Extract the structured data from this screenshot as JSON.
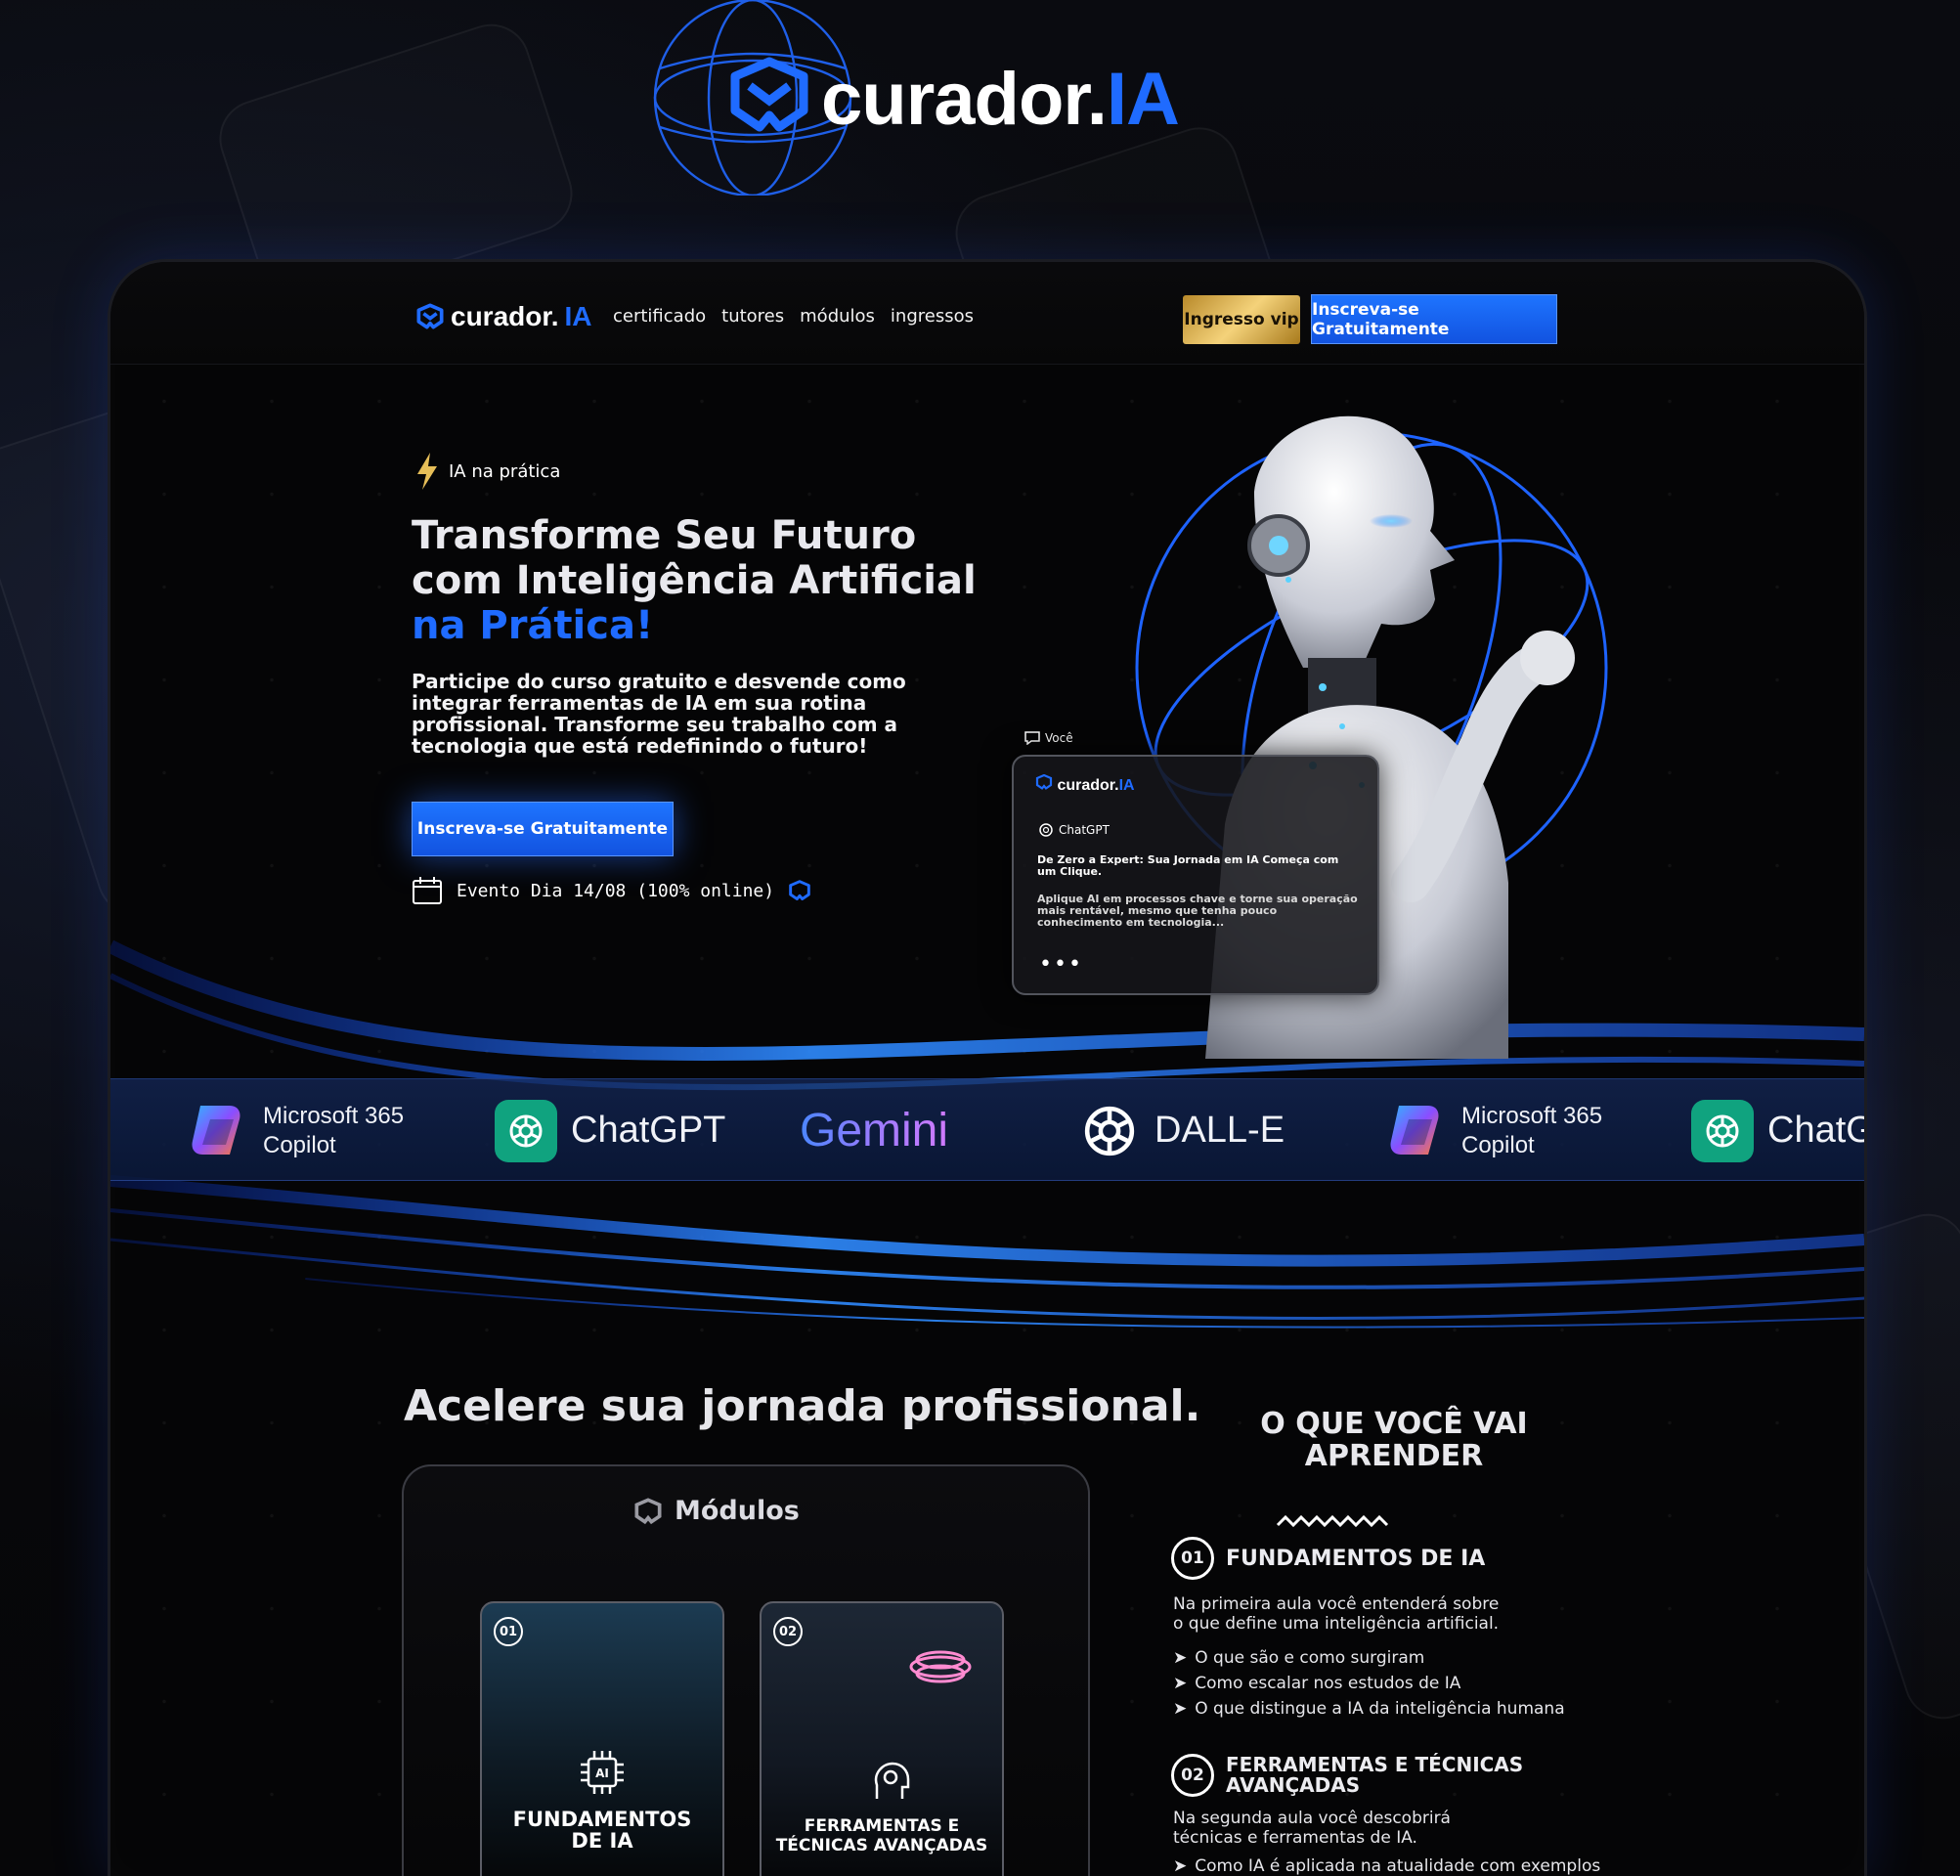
{
  "brand": {
    "name": "curador.",
    "suffix": "IA"
  },
  "nav": {
    "links": [
      "certificado",
      "tutores",
      "módulos",
      "ingressos"
    ],
    "vip_button": "Ingresso vip",
    "cta_button": "Inscreva-se Gratuitamente"
  },
  "hero": {
    "tag": "IA na prática",
    "title_line1": "Transforme Seu Futuro",
    "title_line2": "com Inteligência Artificial",
    "title_highlight": "na Prática!",
    "description": "Participe do curso gratuito e desvende como integrar ferramentas de IA em sua rotina profissional. Transforme seu trabalho com a tecnologia que está redefinindo o futuro!",
    "cta_button": "Inscreva-se Gratuitamente",
    "event": "Evento Dia 14/08 (100% online)"
  },
  "chat": {
    "label": "Você",
    "source": "ChatGPT",
    "question": "De Zero a Expert: Sua Jornada em IA Começa com um Clique.",
    "answer": "Aplique AI em processos chave e torne sua operação mais rentável, mesmo que tenha pouco conhecimento em tecnologia...",
    "dots": "•••"
  },
  "brands": [
    {
      "name_line1": "Microsoft 365",
      "name_line2": "Copilot"
    },
    {
      "name": "ChatGPT"
    },
    {
      "name": "Gemini"
    },
    {
      "name": "DALL-E"
    },
    {
      "name_line1": "Microsoft 365",
      "name_line2": "Copilot"
    },
    {
      "name": "ChatG"
    }
  ],
  "section": {
    "title": "Acelere sua jornada profissional.",
    "modules_title": "Módulos",
    "modules": [
      {
        "num": "01",
        "label_line1": "FUNDAMENTOS",
        "label_line2": "DE IA"
      },
      {
        "num": "02",
        "label_line1": "FERRAMENTAS E",
        "label_line2": "TÉCNICAS AVANÇADAS"
      }
    ]
  },
  "learn": {
    "title_line1": "O QUE VOCÊ VAI",
    "title_line2": "APRENDER",
    "items": [
      {
        "num": "01",
        "title": "FUNDAMENTOS DE IA",
        "text_line1": "Na primeira aula você entenderá sobre",
        "text_line2": "o que define uma inteligência artificial.",
        "bullets": [
          "O que são e como surgiram",
          "Como escalar nos estudos de IA",
          "O que distingue a IA da inteligência humana"
        ]
      },
      {
        "num": "02",
        "title_line1": "FERRAMENTAS E TÉCNICAS",
        "title_line2": "AVANÇADAS",
        "text_line1": "Na segunda aula você descobrirá",
        "text_line2": "técnicas e ferramentas de IA.",
        "bullets": [
          "Como IA é aplicada na atualidade com exemplos"
        ]
      }
    ]
  },
  "colors": {
    "accent": "#1f6bff",
    "gold": "#e6be58",
    "background": "#050506"
  }
}
